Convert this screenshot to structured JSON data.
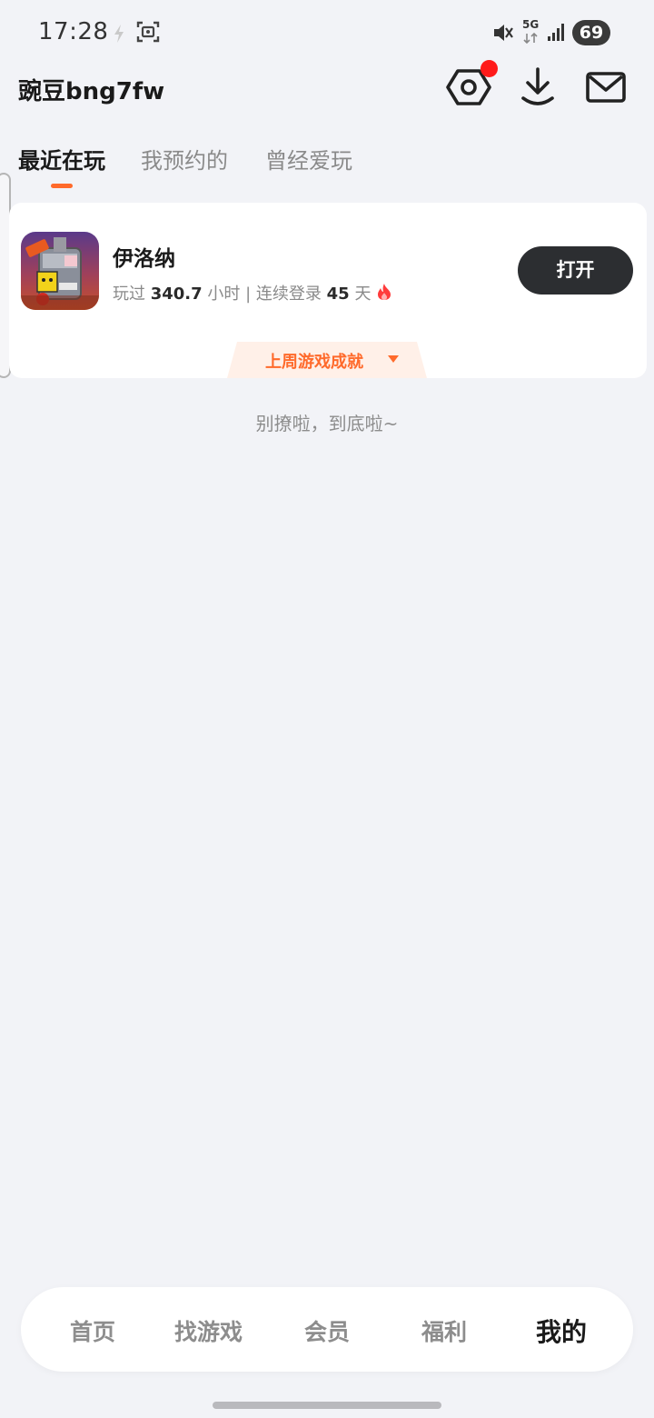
{
  "status_bar": {
    "time": "17:28",
    "battery": "69",
    "network": "5G",
    "icons": [
      "charging-bolt-icon",
      "screenshot-icon",
      "mute-icon",
      "signal-icon"
    ]
  },
  "header": {
    "username": "豌豆bng7fw",
    "icons": [
      "settings-icon",
      "download-icon",
      "mail-icon"
    ],
    "notification_color": "#ff1a1a"
  },
  "tabs": [
    {
      "label": "最近在玩",
      "active": true
    },
    {
      "label": "我预约的",
      "active": false
    },
    {
      "label": "曾经爱玩",
      "active": false
    }
  ],
  "game": {
    "name": "伊洛纳",
    "stats_prefix": "玩过",
    "hours": "340.7",
    "hours_unit": "小时 | 连续登录",
    "days": "45",
    "days_unit": "天",
    "open_label": "打开",
    "achievement_label": "上周游戏成就"
  },
  "end_text": "别撩啦，到底啦~",
  "bottom_nav": [
    {
      "label": "首页",
      "active": false
    },
    {
      "label": "找游戏",
      "active": false
    },
    {
      "label": "会员",
      "active": false
    },
    {
      "label": "福利",
      "active": false
    },
    {
      "label": "我的",
      "active": true
    }
  ],
  "colors": {
    "accent": "#ff6a2b",
    "open_button": "#2c2e31",
    "background": "#f2f3f7"
  }
}
